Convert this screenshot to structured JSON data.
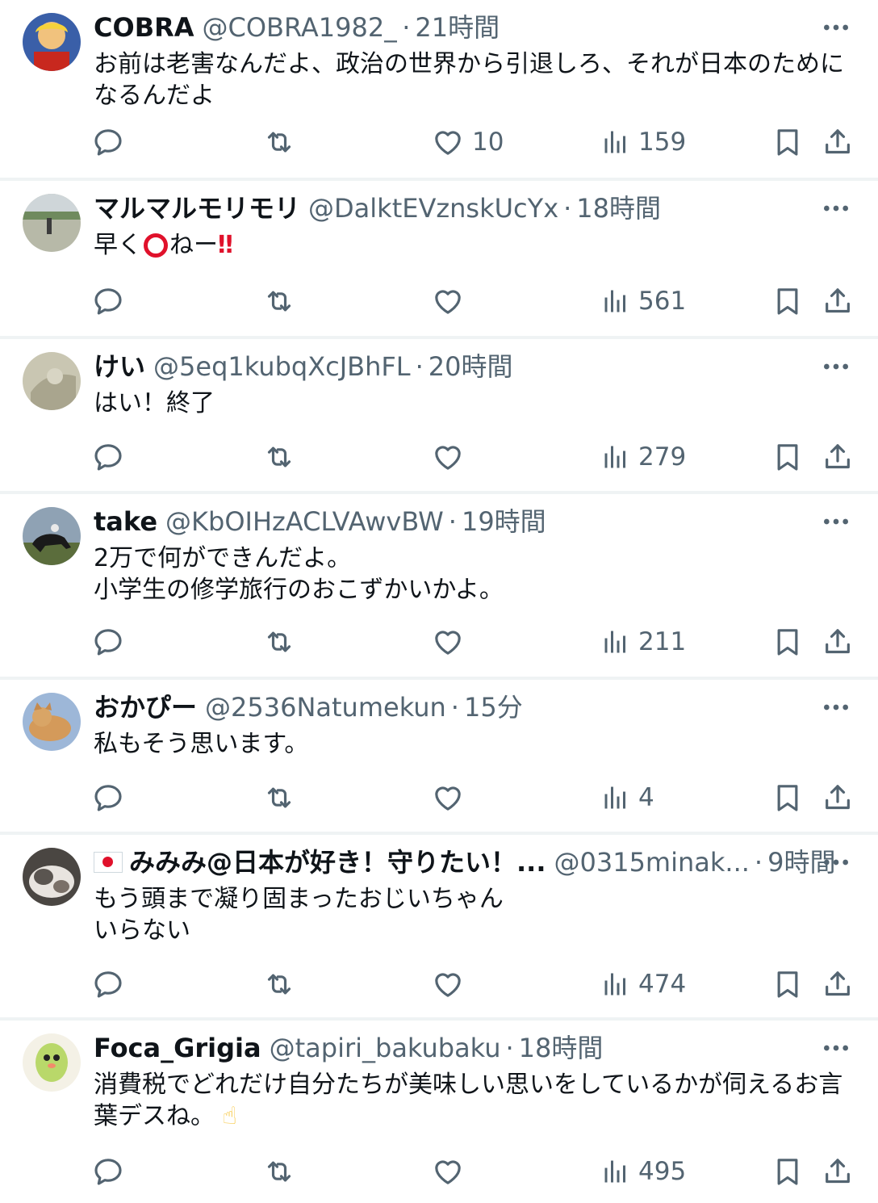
{
  "tweets": [
    {
      "name": "COBRA",
      "handle": "@COBRA1982_",
      "time": "21時間",
      "text": "お前は老害なんだよ、政治の世界から引退しろ、それが日本のために\nなるんだよ",
      "likes": "10",
      "views": "159"
    },
    {
      "name": "マルマルモリモリ",
      "handle": "@DalktEVznskUcYx",
      "time": "18時間",
      "text_a": "早く",
      "text_b": "ねー",
      "text_c": "‼",
      "likes": "",
      "views": "561"
    },
    {
      "name": "けい",
      "handle": "@5eq1kubqXcJBhFL",
      "time": "20時間",
      "text": "はい！終了",
      "likes": "",
      "views": "279"
    },
    {
      "name": "take",
      "handle": "@KbOIHzACLVAwvBW",
      "time": "19時間",
      "text": "2万で何ができんだよ。\n小学生の修学旅行のおこずかいかよ。",
      "likes": "",
      "views": "211"
    },
    {
      "name": "おかぴー",
      "handle": "@2536Natumekun",
      "time": "15分",
      "text": "私もそう思います。",
      "likes": "",
      "views": "4"
    },
    {
      "name": "みみみ@日本が好き！守りたい！...",
      "handle": "@0315minak...",
      "time": "9時間",
      "text": "もう頭まで凝り固まったおじいちゃん\nいらない",
      "likes": "",
      "views": "474"
    },
    {
      "name": "Foca_Grigia",
      "handle": "@tapiri_bakubaku",
      "time": "18時間",
      "text": "消費税でどれだけ自分たちが美味しい思いをしているかが伺えるお言\n葉デスね。",
      "emoji": "☝",
      "likes": "",
      "views": "495"
    }
  ],
  "separator": "·",
  "colors": {
    "text": "#0f1419",
    "secondary": "#536471",
    "divider": "#eff3f4",
    "red": "#e0112b"
  },
  "icons": [
    "reply-icon",
    "retweet-icon",
    "like-icon",
    "views-icon",
    "bookmark-icon",
    "share-icon",
    "more-icon"
  ]
}
